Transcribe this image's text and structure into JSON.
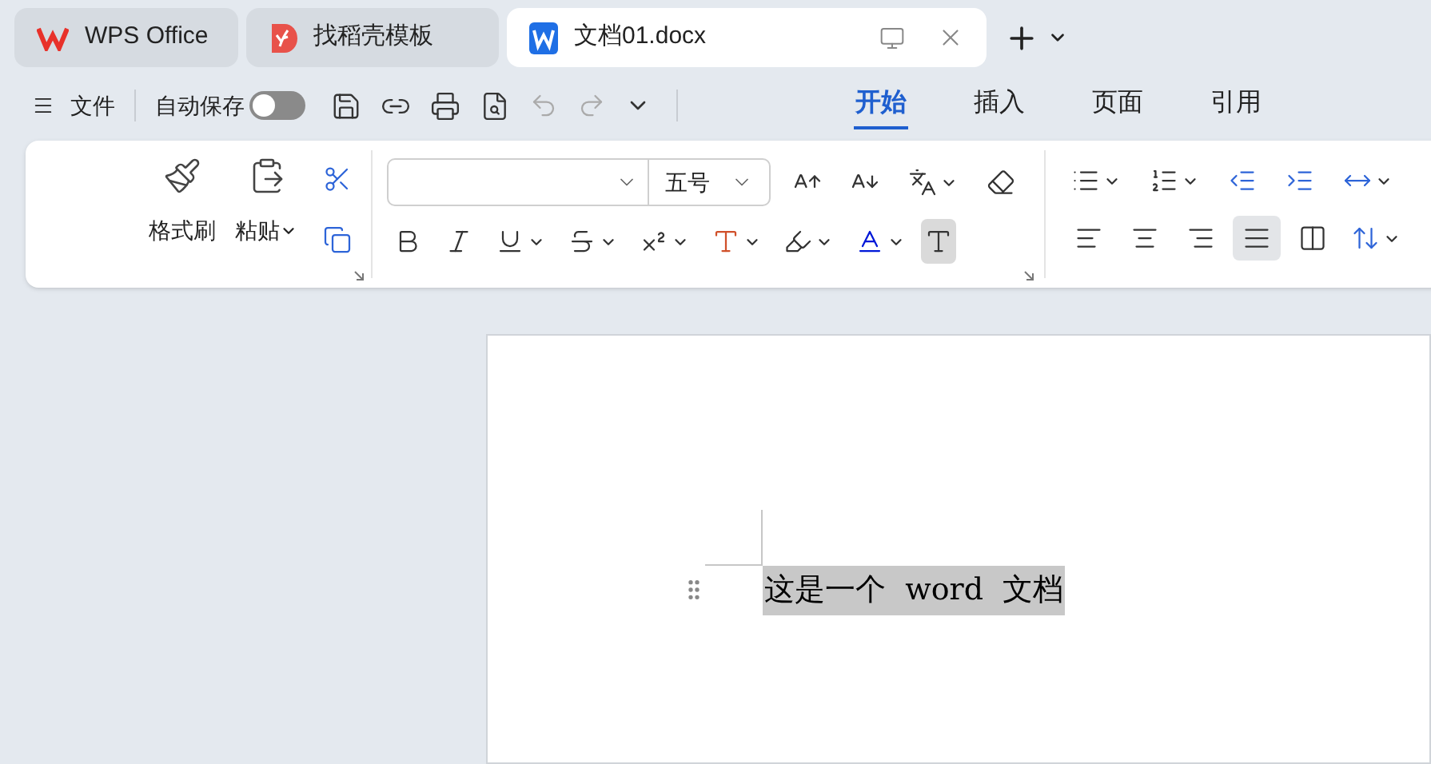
{
  "tabs": [
    {
      "kind": "home",
      "label": "WPS Office",
      "selected": false
    },
    {
      "kind": "templates",
      "label": "找稻壳模板",
      "selected": false
    },
    {
      "kind": "document",
      "label": "文档01.docx",
      "selected": true
    }
  ],
  "toolbar": {
    "file_menu": "文件",
    "autosave": {
      "label": "自动保存",
      "on": false
    }
  },
  "ribbon_tabs": [
    {
      "label": "开始",
      "selected": true
    },
    {
      "label": "插入",
      "selected": false
    },
    {
      "label": "页面",
      "selected": false
    },
    {
      "label": "引用",
      "selected": false
    }
  ],
  "ribbon": {
    "format_painter": "格式刷",
    "paste": "粘贴",
    "font_size": "五号",
    "alignment": [
      {
        "kind": "left",
        "selected": false
      },
      {
        "kind": "center",
        "selected": false
      },
      {
        "kind": "right",
        "selected": false
      },
      {
        "kind": "justify",
        "selected": true
      },
      {
        "kind": "distributed",
        "selected": false
      }
    ]
  },
  "document": {
    "paragraph": {
      "text": "这是一个  word  文档",
      "selected": true
    }
  }
}
